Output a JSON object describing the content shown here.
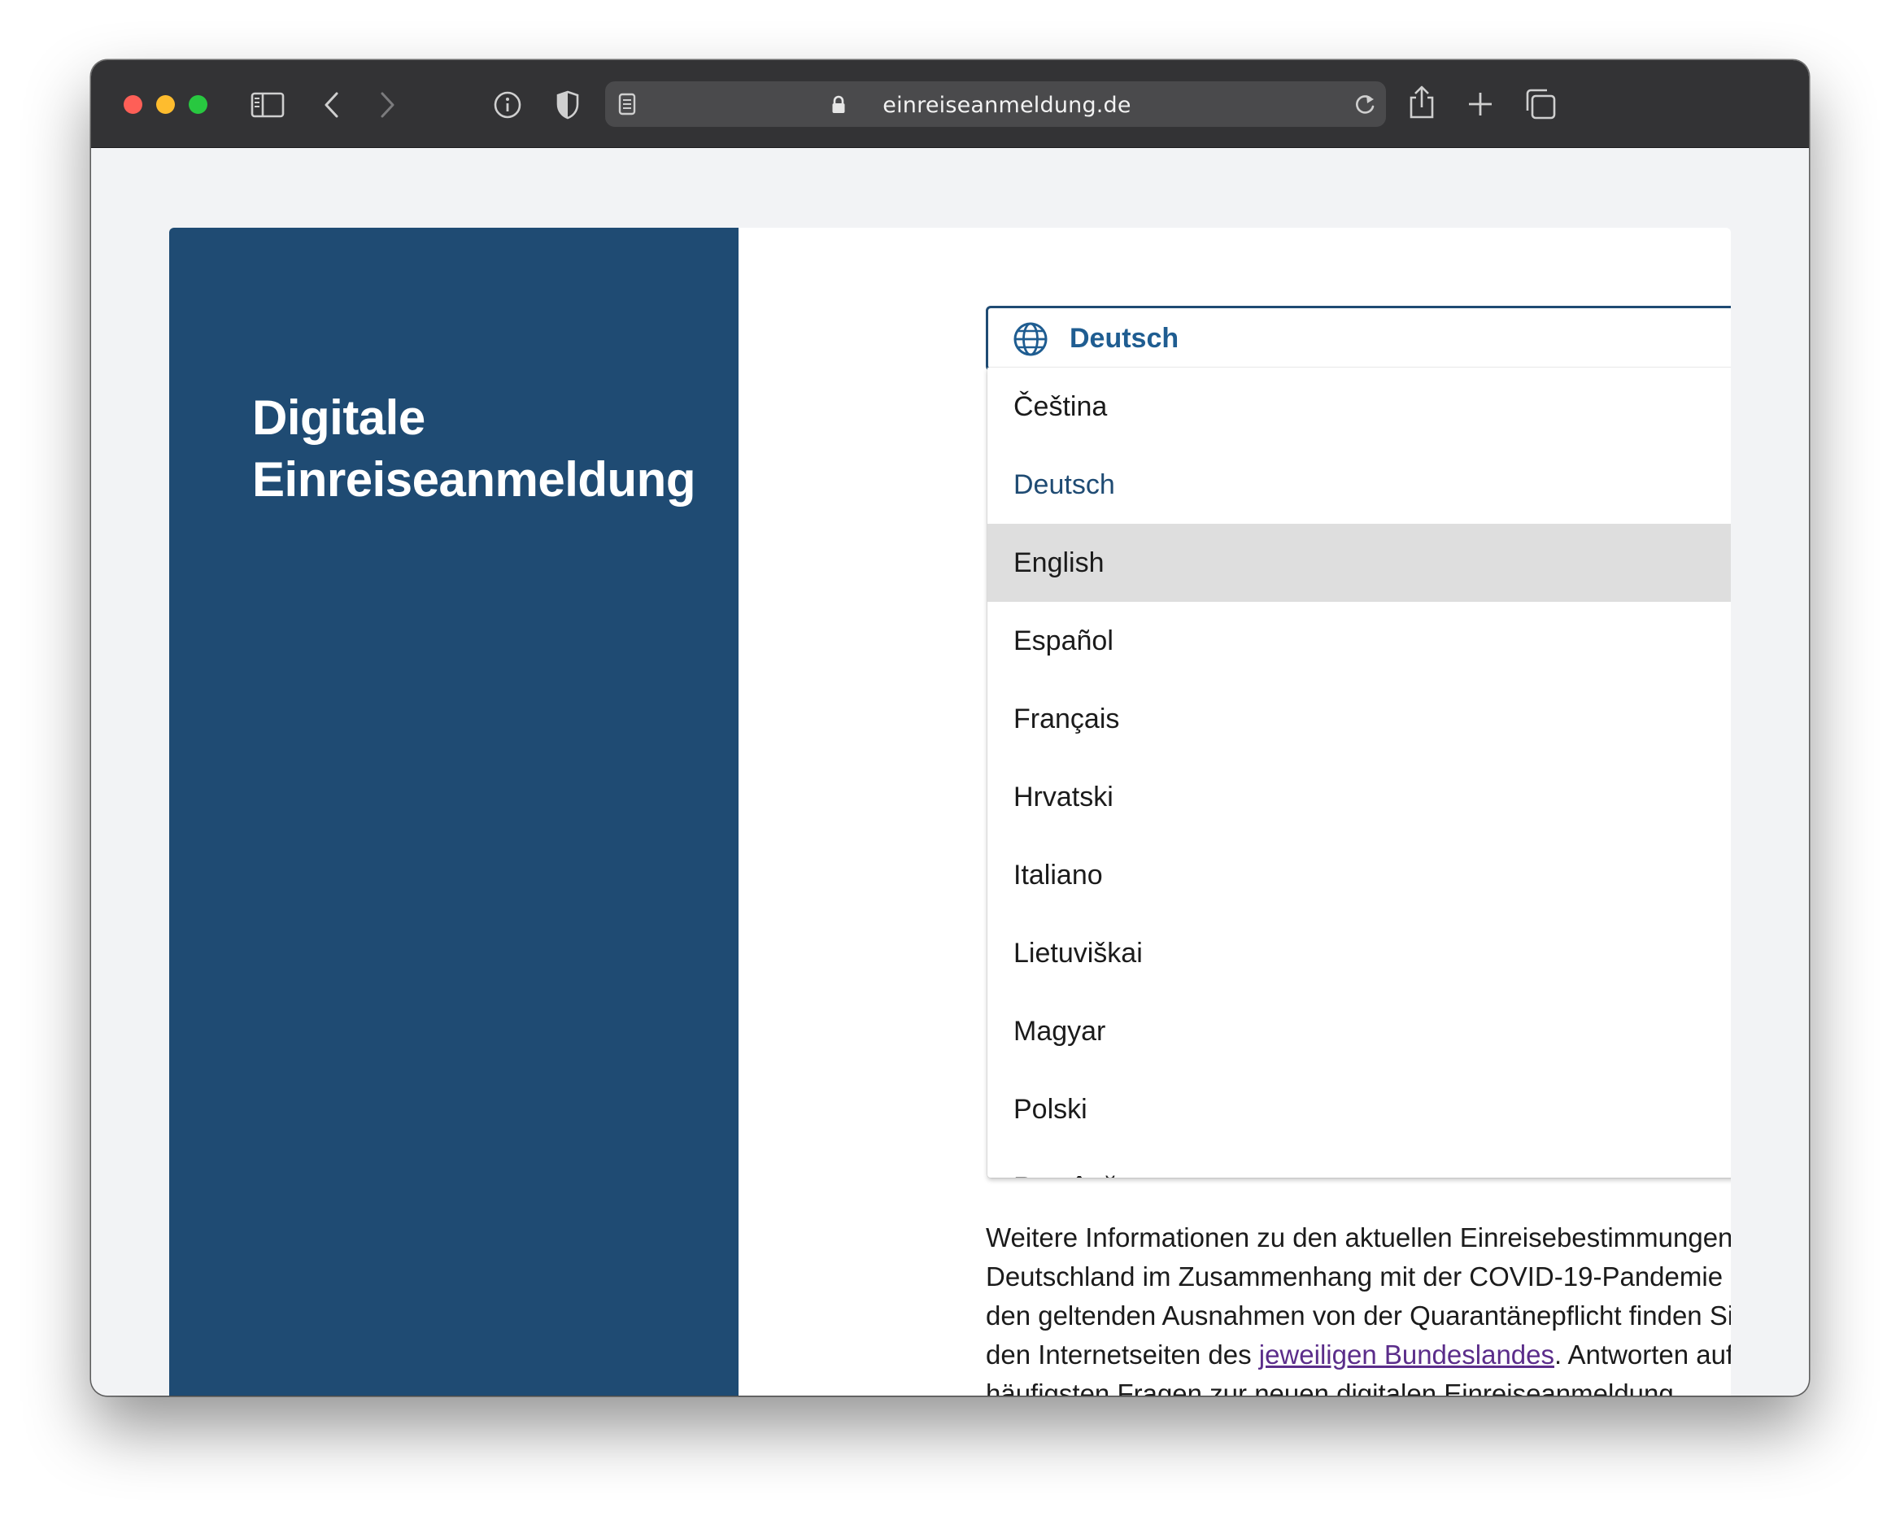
{
  "browser": {
    "url": "einreiseanmeldung.de"
  },
  "page": {
    "side_title": "Digitale Einreiseanmeldung",
    "language_select": {
      "value": "Deutsch",
      "options": [
        "Čeština",
        "Deutsch",
        "English",
        "Español",
        "Français",
        "Hrvatski",
        "Italiano",
        "Lietuviškai",
        "Magyar",
        "Polski",
        "Română"
      ],
      "selected": "Deutsch",
      "hovered": "English"
    },
    "info": {
      "text_before": "Weitere Informationen zu den aktuellen Einreisebestimmungen nach Deutschland im Zusammenhang mit der COVID-19-Pandemie und zu den geltenden Ausnahmen von der Quarantänepflicht finden Sie auf den Internetseiten des ",
      "link": "jeweiligen Bundeslandes",
      "text_after": ". Antworten auf die häufigsten Fragen zur neuen digitalen Einreiseanmeldung"
    }
  },
  "colors": {
    "side_panel": "#1f4b73",
    "accent": "#1f5d91",
    "hover": "#dedede",
    "link": "#5b2d8a"
  },
  "icons": [
    "close-light",
    "minimize-light",
    "zoom-light",
    "sidebar-icon",
    "back-icon",
    "forward-icon",
    "info-icon",
    "shield-icon",
    "reader-icon",
    "lock-icon",
    "reload-icon",
    "share-icon",
    "new-tab-icon",
    "tabs-overview-icon",
    "globe-icon",
    "chevron-up-icon"
  ]
}
